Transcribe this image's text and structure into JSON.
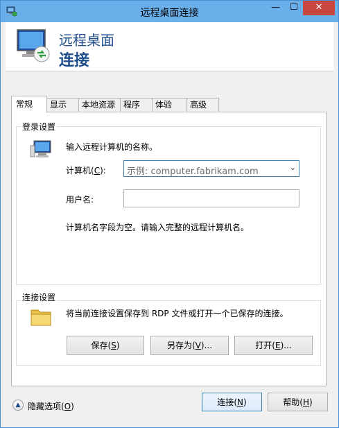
{
  "window": {
    "title": "远程桌面连接",
    "controls": {
      "minimize": "—",
      "maximize": "☐",
      "close": "✕"
    }
  },
  "banner": {
    "line1": "远程桌面",
    "line2": "连接"
  },
  "tabs": [
    {
      "label": "常规",
      "active": true
    },
    {
      "label": "显示"
    },
    {
      "label": "本地资源"
    },
    {
      "label": "程序"
    },
    {
      "label": "体验"
    },
    {
      "label": "高级"
    }
  ],
  "logon_settings": {
    "group_label": "登录设置",
    "instruction": "输入远程计算机的名称。",
    "computer_label": "计算机(C):",
    "computer_label_text": "计算机(",
    "computer_label_key": "C",
    "computer_label_end": "):",
    "computer_placeholder": "示例: computer.fabrikam.com",
    "username_label": "用户名:",
    "username_value": "",
    "warning": "计算机名字段为空。请输入完整的远程计算机名。"
  },
  "connection_settings": {
    "group_label": "连接设置",
    "description": "将当前连接设置保存到 RDP 文件或打开一个已保存的连接。",
    "save": {
      "text": "保存(",
      "key": "S",
      "end": ")"
    },
    "save_as": {
      "text": "另存为(",
      "key": "V",
      "end": ")..."
    },
    "open": {
      "text": "打开(",
      "key": "E",
      "end": ")..."
    }
  },
  "footer": {
    "hide_options": {
      "text": "隐藏选项(",
      "key": "O",
      "end": ")"
    },
    "connect": {
      "text": "连接(",
      "key": "N",
      "end": ")"
    },
    "help": {
      "text": "帮助(",
      "key": "H",
      "end": ")"
    }
  }
}
